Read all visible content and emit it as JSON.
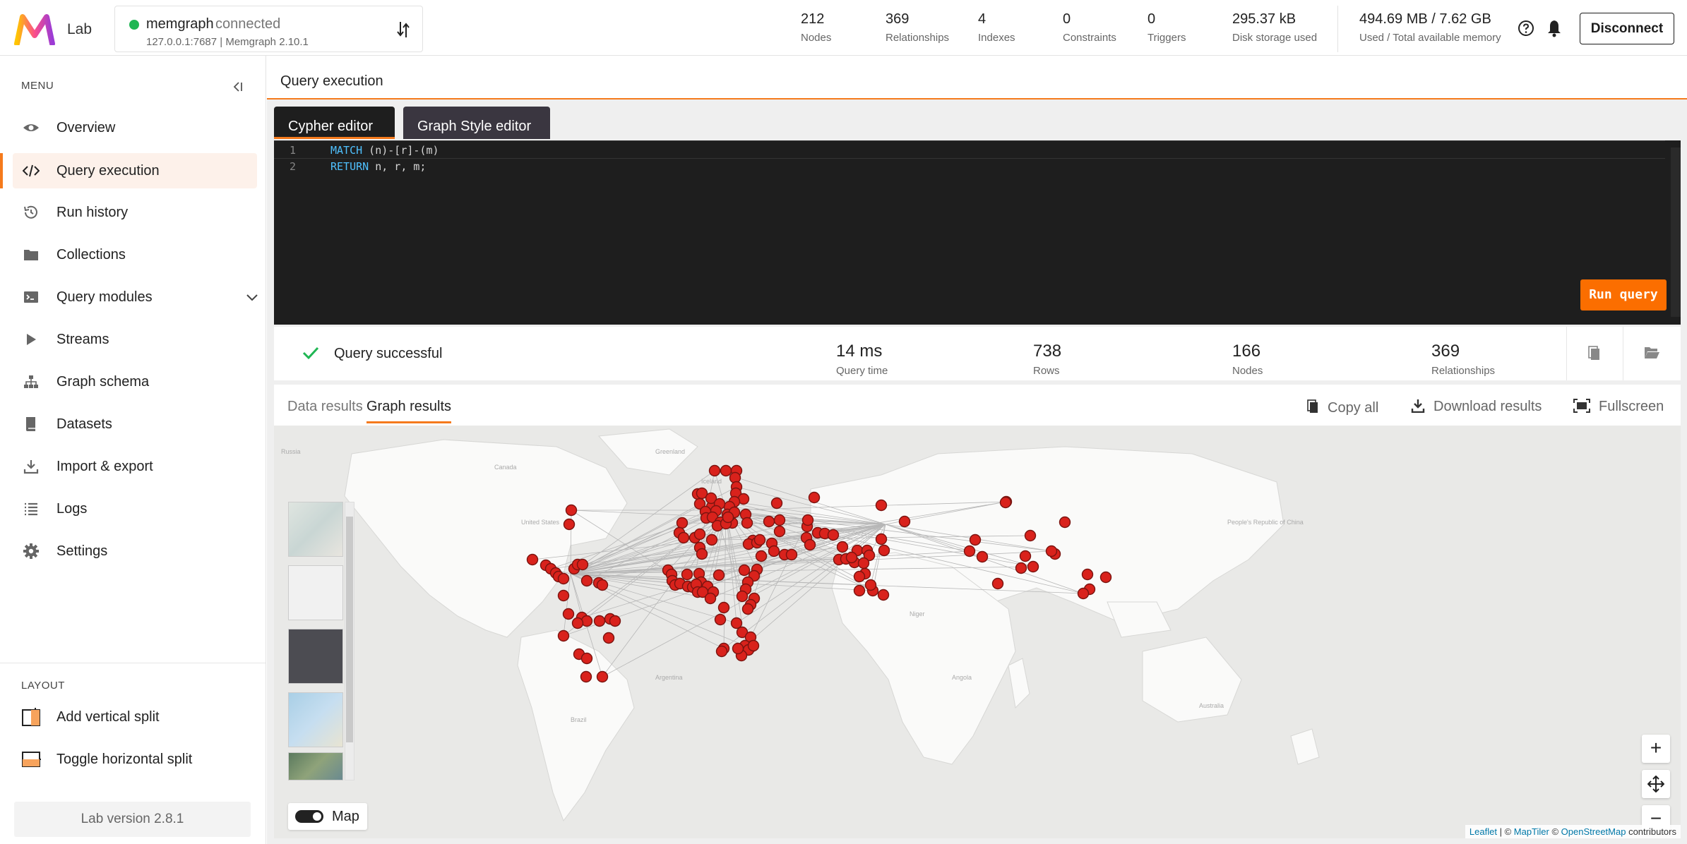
{
  "app": {
    "name": "Lab",
    "accent": "#f57a1c"
  },
  "connection": {
    "name": "memgraph",
    "status": "connected",
    "address": "127.0.0.1:7687 | Memgraph 2.10.1",
    "status_color": "#1fb653"
  },
  "stats": [
    {
      "value": "212",
      "label": "Nodes"
    },
    {
      "value": "369",
      "label": "Relationships"
    },
    {
      "value": "4",
      "label": "Indexes"
    },
    {
      "value": "0",
      "label": "Constraints"
    },
    {
      "value": "0",
      "label": "Triggers"
    },
    {
      "value": "295.37 kB",
      "label": "Disk storage used"
    },
    {
      "value": "494.69 MB / 7.62 GB",
      "label": "Used / Total available memory"
    }
  ],
  "header_actions": {
    "disconnect": "Disconnect"
  },
  "sidebar": {
    "menu_label": "MENU",
    "items": [
      {
        "label": "Overview",
        "icon": "eye-icon"
      },
      {
        "label": "Query execution",
        "icon": "code-icon"
      },
      {
        "label": "Run history",
        "icon": "history-icon"
      },
      {
        "label": "Collections",
        "icon": "folder-icon"
      },
      {
        "label": "Query modules",
        "icon": "terminal-icon"
      },
      {
        "label": "Streams",
        "icon": "play-icon"
      },
      {
        "label": "Graph schema",
        "icon": "schema-icon"
      },
      {
        "label": "Datasets",
        "icon": "book-icon"
      },
      {
        "label": "Import & export",
        "icon": "download-icon"
      },
      {
        "label": "Logs",
        "icon": "list-icon"
      },
      {
        "label": "Settings",
        "icon": "gear-icon"
      }
    ],
    "layout_label": "LAYOUT",
    "layout_items": [
      {
        "label": "Add vertical split"
      },
      {
        "label": "Toggle horizontal split"
      }
    ],
    "version": "Lab version 2.8.1"
  },
  "main": {
    "title": "Query execution",
    "editor_tabs": [
      "Cypher editor",
      "Graph Style editor"
    ],
    "code": {
      "line1": {
        "num": "1",
        "kw": "MATCH",
        "rest": " (n)-[r]-(m)"
      },
      "line2": {
        "num": "2",
        "kw": "RETURN",
        "rest": " n, r, m;"
      }
    },
    "run_label": "Run query",
    "result": {
      "status": "Query successful",
      "stats": [
        {
          "value": "14 ms",
          "label": "Query time"
        },
        {
          "value": "738",
          "label": "Rows"
        },
        {
          "value": "166",
          "label": "Nodes"
        },
        {
          "value": "369",
          "label": "Relationships"
        }
      ]
    },
    "result_tabs": [
      "Data results",
      "Graph results"
    ],
    "result_actions": [
      "Copy all",
      "Download results",
      "Fullscreen"
    ],
    "map": {
      "toggle_label": "Map",
      "zoom_in": "+",
      "zoom_out": "−",
      "attribution": {
        "leaflet": "Leaflet",
        "sep": " | © ",
        "maptiler": "MapTiler",
        "osm_pre": " © ",
        "osm": "OpenStreetMap",
        "osm_post": " contributors"
      },
      "node_color": "#d9221c"
    }
  }
}
